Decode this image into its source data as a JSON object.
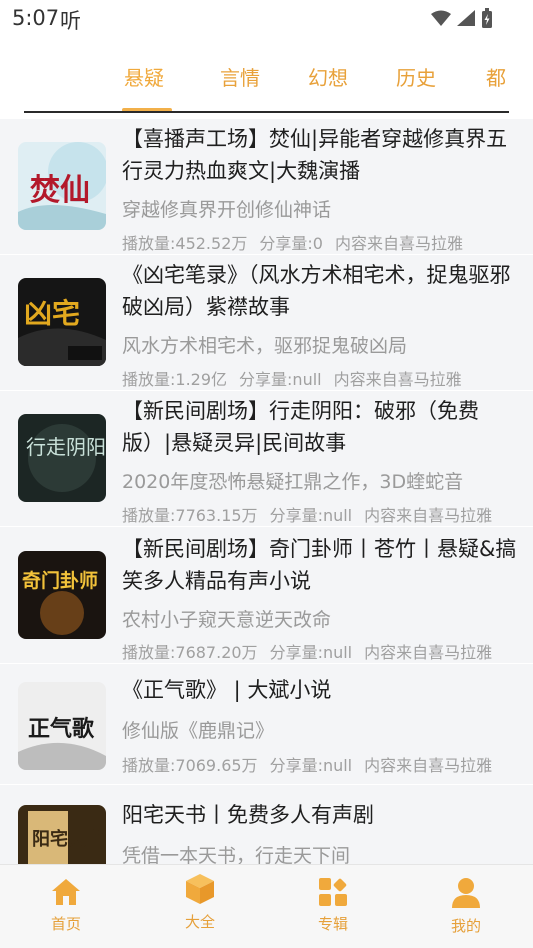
{
  "status_bar": {
    "time": "5:07",
    "carrier": "听"
  },
  "tabs": [
    {
      "label": "悬疑",
      "active": true
    },
    {
      "label": "言情",
      "active": false
    },
    {
      "label": "幻想",
      "active": false
    },
    {
      "label": "历史",
      "active": false
    },
    {
      "label": "都",
      "active": false
    }
  ],
  "items": [
    {
      "title": "【喜播声工场】焚仙|异能者穿越修真界五行灵力热血爽文|大魏演播",
      "desc": "穿越修真界开创修仙神话",
      "plays": "播放量:452.52万",
      "shares": "分享量:0",
      "source": "内容来自喜马拉雅",
      "cover_text": "焚仙"
    },
    {
      "title": "《凶宅笔录》（风水方术相宅术，捉鬼驱邪破凶局）紫襟故事",
      "desc": "风水方术相宅术，驱邪捉鬼破凶局",
      "plays": "播放量:1.29亿",
      "shares": "分享量:null",
      "source": "内容来自喜马拉雅",
      "cover_text": "凶宅"
    },
    {
      "title": "【新民间剧场】行走阴阳：破邪（免费版）|悬疑灵异|民间故事",
      "desc": "2020年度恐怖悬疑扛鼎之作，3D蝰蛇音",
      "plays": "播放量:7763.15万",
      "shares": "分享量:null",
      "source": "内容来自喜马拉雅",
      "cover_text": "行走阴阳"
    },
    {
      "title": "【新民间剧场】奇门卦师丨苍竹丨悬疑&搞笑多人精品有声小说",
      "desc": "农村小子窥天意逆天改命",
      "plays": "播放量:7687.20万",
      "shares": "分享量:null",
      "source": "内容来自喜马拉雅",
      "cover_text": "奇门卦师"
    },
    {
      "title": "《正气歌》 | 大斌小说",
      "desc": "修仙版《鹿鼎记》",
      "plays": "播放量:7069.65万",
      "shares": "分享量:null",
      "source": "内容来自喜马拉雅",
      "cover_text": "正气歌"
    },
    {
      "title": "阳宅天书丨免费多人有声剧",
      "desc": "凭借一本天书，行走天下间",
      "plays": "",
      "shares": "",
      "source": "",
      "cover_text": "阳宅天书"
    }
  ],
  "bottom_nav": [
    {
      "label": "首页",
      "icon": "home-icon"
    },
    {
      "label": "大全",
      "icon": "cube-icon"
    },
    {
      "label": "专辑",
      "icon": "album-grid-icon"
    },
    {
      "label": "我的",
      "icon": "person-icon"
    }
  ],
  "colors": {
    "accent": "#f0a93c",
    "list_bg": "#f4f5f7"
  }
}
